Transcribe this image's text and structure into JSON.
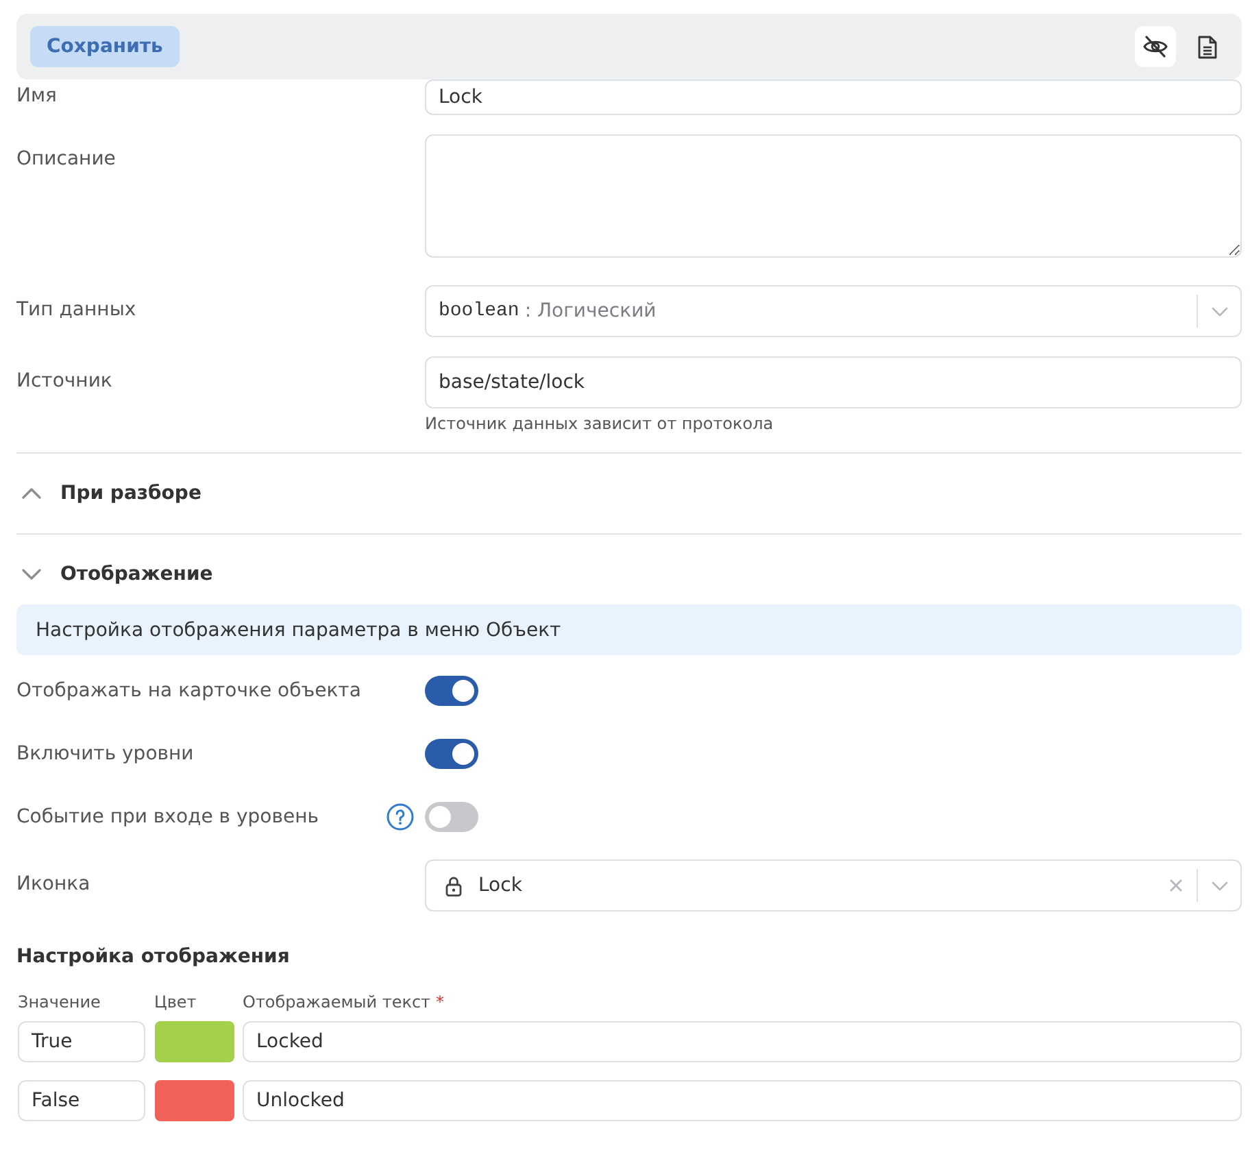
{
  "toolbar": {
    "save_button": {
      "label": "Сохранить",
      "disabled": true
    },
    "icon_buttons": [
      {
        "kind": "visibility",
        "selected": true
      },
      {
        "kind": "document",
        "selected": false
      }
    ]
  },
  "fields": [
    {
      "kind": "text",
      "label": "Имя",
      "value": "Lock"
    },
    {
      "kind": "textarea",
      "label": "Описание"
    },
    {
      "kind": "select",
      "label": "Тип данных",
      "code": "boolean",
      "value": ": Логический"
    },
    {
      "kind": "text",
      "label": "Источник",
      "value": "base/state/lock",
      "hint": "Источник данных зависит от протокола"
    }
  ],
  "sections": [
    {
      "title": "При разборе",
      "expanded": false
    },
    {
      "title": "Отображение",
      "expanded": true,
      "info": "Настройка отображения параметра в меню Объект",
      "toggles": [
        {
          "label": "Отображать на карточке объекта",
          "on": true,
          "help": false
        },
        {
          "label": "Включить уровни",
          "on": true,
          "help": false
        },
        {
          "label": "Событие при входе в уровень",
          "on": false,
          "help": true
        }
      ],
      "icon_field": {
        "label": "Иконка",
        "value": "Lock"
      },
      "display_settings": {
        "title": "Настройка отображения",
        "columns": [
          {
            "label": "Значение"
          },
          {
            "label": "Цвет"
          },
          {
            "label": "Отображаемый текст",
            "required_mark": "*"
          }
        ],
        "rows": [
          {
            "value": "True",
            "color": "#a4d04c",
            "text": "Locked"
          },
          {
            "value": "False",
            "color": "#f0625a",
            "text": "Unlocked"
          }
        ]
      }
    }
  ]
}
